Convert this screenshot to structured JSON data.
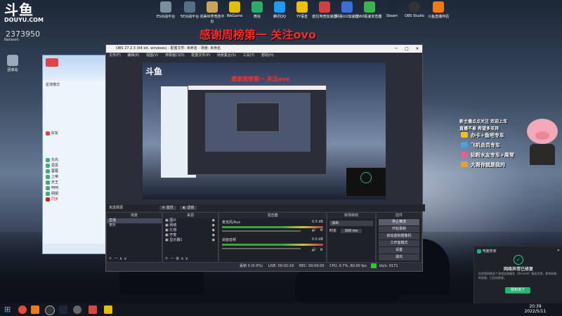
{
  "desktop": {
    "logo_text": "斗鱼",
    "logo_domain": "DOUYU.COM",
    "room_number": "2373950",
    "network_label": "Network",
    "recycle_label": "回收站",
    "icons": [
      "ES对战平台",
      "5E对战平台",
      "完美世界竞技平台",
      "WeGame",
      "微信",
      "腾讯QQ",
      "YY语音",
      "欧拉电竞加速器",
      "网易UU加速器",
      "360极速浏览器",
      "Steam",
      "OBS Studio",
      "斗鱼直播伴侣"
    ],
    "banner": "感谢周榜第一 关注ovo"
  },
  "buddy_list": {
    "rows": [
      "好友",
      "先先",
      "思思",
      "蓉蓉",
      "上帝",
      "天王",
      "呵呵",
      "朋朋",
      "同步"
    ],
    "search_hint": "星球模式"
  },
  "obs": {
    "title": "OBS 27.2.3 (64 bit, windows) - 配置文件: 未命名 - 场景: 未命名",
    "menu": [
      "文件(F)",
      "编辑(E)",
      "视图(V)",
      "停靠窗口(D)",
      "配置文件(P)",
      "场景集合(S)",
      "工具(T)",
      "帮助(H)"
    ],
    "preview_banner": "感谢周榜第一 关注ovo",
    "no_source": "未选择源",
    "props_label": "属性",
    "filters_label": "滤镜",
    "docks": {
      "scenes": "场景",
      "sources": "来源",
      "mixer": "混音器",
      "transitions": "转场特效",
      "controls": "控件"
    },
    "scenes": [
      "直播",
      "宠乐"
    ],
    "sources": [
      "图片",
      "网络",
      "礼物",
      "开麦",
      "显示器1"
    ],
    "mixer": [
      {
        "name": "麦克风/Aux",
        "db": "0.0 dB"
      },
      {
        "name": "桌面音频",
        "db": "0.0 dB"
      }
    ],
    "transition": {
      "type": "淡出",
      "duration_label": "时长",
      "duration": "300 ms"
    },
    "controls": [
      "停止推流",
      "开始录制",
      "启动虚拟摄像机",
      "工作室模式",
      "设置",
      "退出"
    ],
    "status": {
      "dropped": "丢帧 0 (0.0%)",
      "live": "LIVE: 00:02:19",
      "rec": "REC: 00:00:00",
      "cpu": "CPU: 0.7%, 60.00 fps",
      "kbps": "kb/s: 9171"
    }
  },
  "stickers": {
    "header1": "新主播点点关注 欢迎上车",
    "header2": "直播不易 希望多支持",
    "lines": [
      "办卡+鱼吧专车",
      "飞机会员专车",
      "钻粉水友专车+周常",
      "大哥你就是我的"
    ]
  },
  "notification": {
    "app": "电脑管家",
    "title": "网络异常已修复",
    "body": "检测到网络多个游戏加速服务（Tencent）服务异常，影响网络的连接，已自动修复。",
    "button": "我知道了"
  },
  "taskbar": {
    "time": "20:39",
    "date": "2022/5/11"
  }
}
